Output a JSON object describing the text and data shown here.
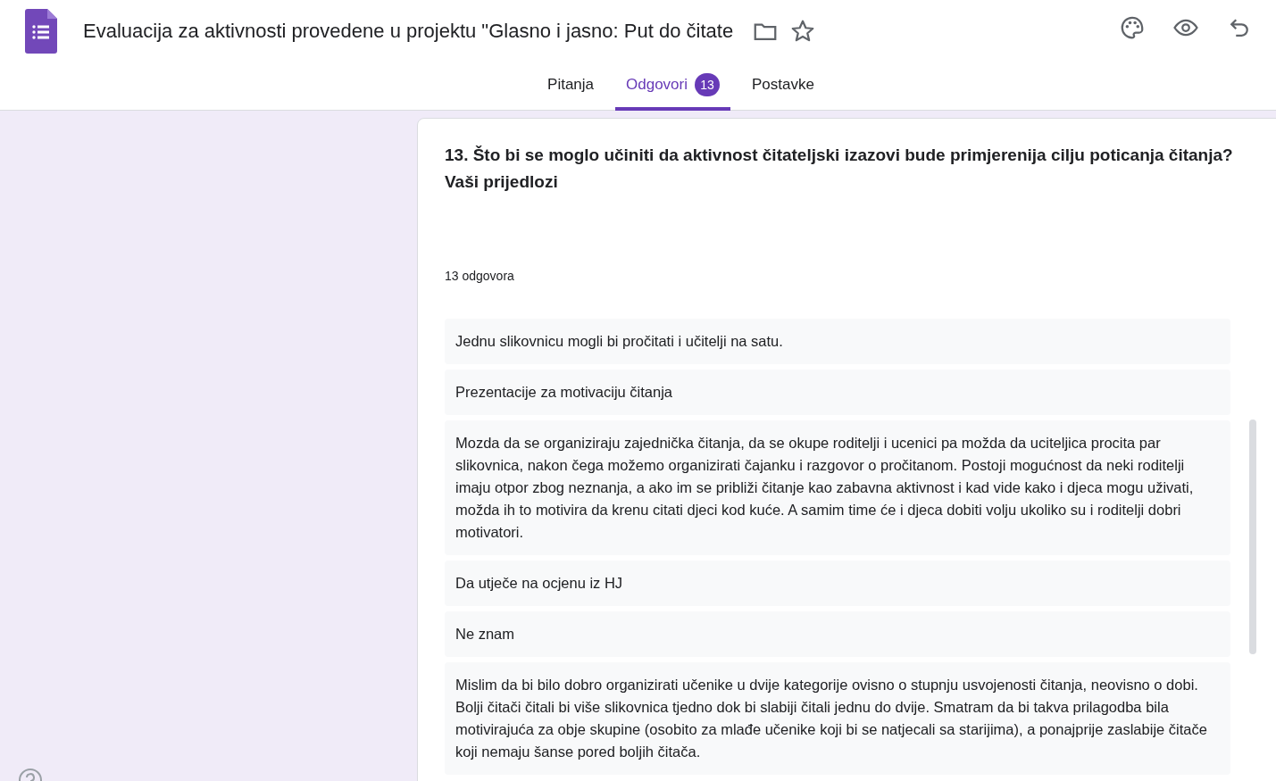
{
  "header": {
    "title": "Evaluacija za aktivnosti provedene u projektu \"Glasno i jasno: Put do čitate"
  },
  "tabs": [
    {
      "label": "Pitanja",
      "selected": false
    },
    {
      "label": "Odgovori",
      "selected": true,
      "badge": "13"
    },
    {
      "label": "Postavke",
      "selected": false
    }
  ],
  "question": {
    "title": "13. Što bi se moglo učiniti da aktivnost čitateljski izazovi bude primjerenija cilju poticanja čitanja? Vaši prijedlozi",
    "count": "13 odgovora"
  },
  "responses": [
    "Jednu slikovnicu mogli bi pročitati i učitelji na satu.",
    "Prezentacije za motivaciju čitanja",
    "Mozda da se organiziraju zajednička čitanja, da se okupe roditelji i ucenici pa možda da uciteljica procita par slikovnica, nakon čega možemo organizirati čajanku i razgovor o pročitanom. Postoji mogućnost da neki roditelji imaju otpor zbog neznanja, a ako im se približi čitanje kao zabavna aktivnost i kad vide kako i djeca mogu uživati, možda ih to motivira da krenu citati djeci kod kuće. A samim time će i djeca dobiti volju ukoliko su i roditelji dobri motivatori.",
    "Da utječe na ocjenu iz HJ",
    "Ne znam",
    "Mislim da bi bilo dobro organizirati učenike u dvije kategorije ovisno o stupnju usvojenosti čitanja, neovisno o dobi. Bolji čitači čitali bi više slikovnica tjedno dok bi slabiji čitali jednu do dvije. Smatram da bi takva prilagodba bila motivirajuća za obje skupine (osobito za mlađe učenike koji bi se natjecali sa starijima), a ponajprije zaslabije čitače koji nemaju šanse pored boljih čitača."
  ]
}
